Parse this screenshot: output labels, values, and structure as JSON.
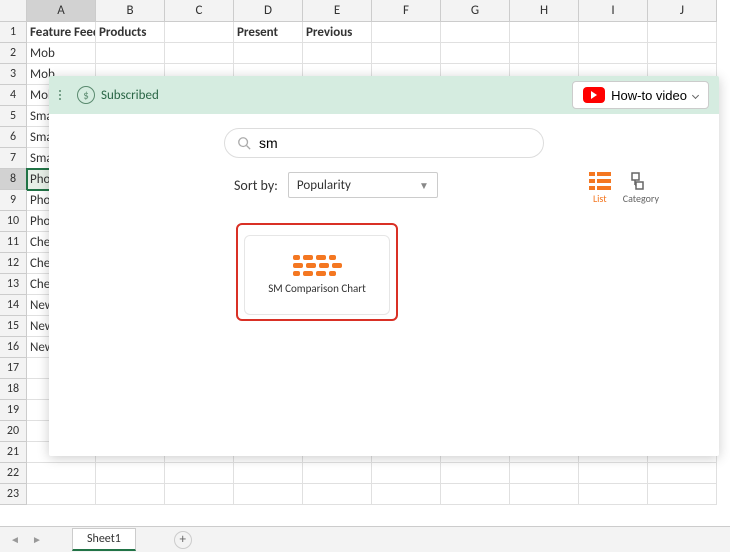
{
  "columns": [
    "A",
    "B",
    "C",
    "D",
    "E",
    "F",
    "G",
    "H",
    "I",
    "J"
  ],
  "header_row": [
    "Feature Feedback",
    "Products",
    "",
    "Present",
    "Previous",
    "",
    "",
    "",
    "",
    ""
  ],
  "rows": [
    "Mob",
    "Mob",
    "Mob",
    "Sma",
    "Sma",
    "Sma",
    "Pho",
    "Pho",
    "Pho",
    "Che",
    "Che",
    "Che",
    "New",
    "New",
    "New",
    "",
    "",
    "",
    "",
    "",
    "",
    ""
  ],
  "selected": {
    "row": 8,
    "col": 1
  },
  "panel": {
    "subscribed": "Subscribed",
    "howto": "How-to video",
    "search_value": "sm",
    "sort_label": "Sort by:",
    "sort_value": "Popularity",
    "view_list": "List",
    "view_category": "Category",
    "result_label": "SM Comparison Chart"
  },
  "sheet_tab": "Sheet1"
}
